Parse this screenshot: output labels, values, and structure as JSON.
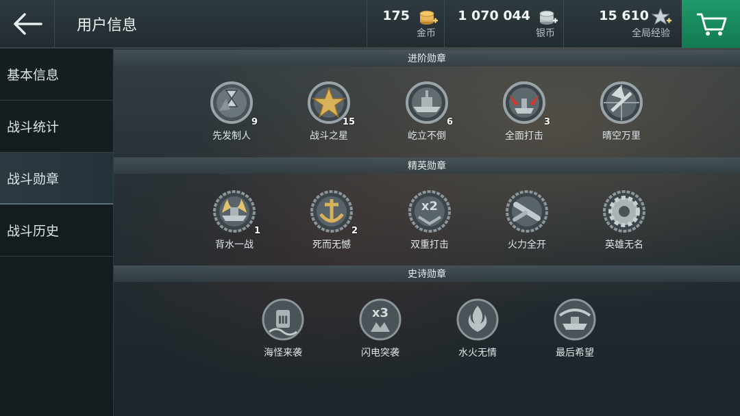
{
  "header": {
    "title": "用户信息",
    "gold": {
      "amount": "175",
      "label": "金币"
    },
    "silver": {
      "amount": "1 070 044",
      "label": "银币"
    },
    "xp": {
      "amount": "15 610",
      "label": "全局经验"
    }
  },
  "sidebar": {
    "items": [
      {
        "label": "基本信息"
      },
      {
        "label": "战斗统计"
      },
      {
        "label": "战斗勋章"
      },
      {
        "label": "战斗历史"
      }
    ],
    "active_index": 2
  },
  "sections": [
    {
      "title": "进阶勋章",
      "medals": [
        {
          "name": "先发制人",
          "count": "9",
          "icon": "hourglass-ship-medal-icon"
        },
        {
          "name": "战斗之星",
          "count": "15",
          "icon": "gold-star-medal-icon"
        },
        {
          "name": "屹立不倒",
          "count": "6",
          "icon": "battleship-medal-icon"
        },
        {
          "name": "全面打击",
          "count": "3",
          "icon": "red-strike-ship-medal-icon"
        },
        {
          "name": "晴空万里",
          "count": "",
          "icon": "crossed-plane-medal-icon"
        }
      ]
    },
    {
      "title": "精英勋章",
      "medals": [
        {
          "name": "背水一战",
          "count": "1",
          "icon": "gold-flame-ship-medal-icon"
        },
        {
          "name": "死而无憾",
          "count": "2",
          "icon": "gold-anchor-medal-icon"
        },
        {
          "name": "双重打击",
          "count": "",
          "icon": "x2-medal-icon"
        },
        {
          "name": "火力全开",
          "count": "",
          "icon": "torpedo-medal-icon"
        },
        {
          "name": "英雄无名",
          "count": "",
          "icon": "gear-medal-icon"
        }
      ]
    },
    {
      "title": "史诗勋章",
      "medals": [
        {
          "name": "海怪来袭",
          "count": "",
          "icon": "kraken-medal-icon"
        },
        {
          "name": "闪电突袭",
          "count": "",
          "icon": "x3-medal-icon"
        },
        {
          "name": "水火无情",
          "count": "",
          "icon": "fire-water-medal-icon"
        },
        {
          "name": "最后希望",
          "count": "",
          "icon": "last-hope-ship-medal-icon"
        }
      ]
    }
  ],
  "colors": {
    "cart_green": "#1a8a5e",
    "gold": "#d8b25a",
    "silver": "#a8b0b4",
    "red_accent": "#d8382a"
  }
}
